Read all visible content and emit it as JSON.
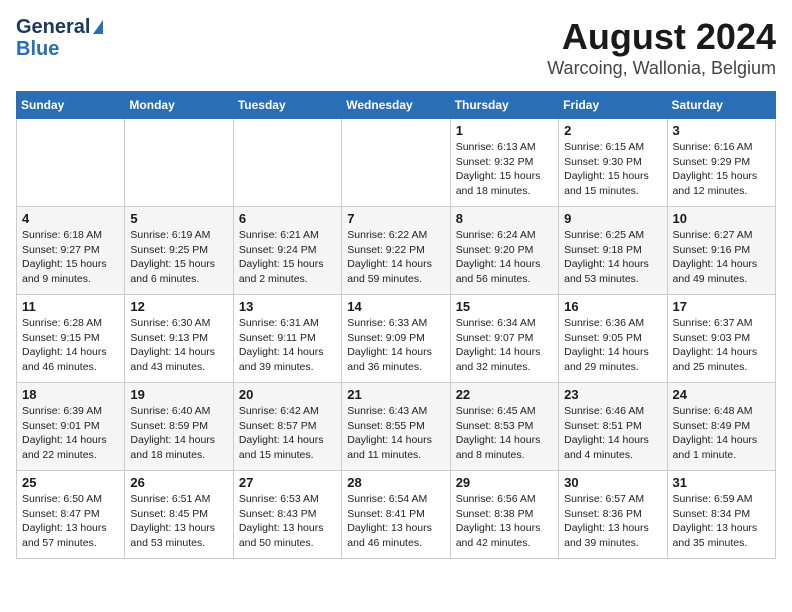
{
  "logo": {
    "line1": "General",
    "line2": "Blue"
  },
  "title": "August 2024",
  "subtitle": "Warcoing, Wallonia, Belgium",
  "days_of_week": [
    "Sunday",
    "Monday",
    "Tuesday",
    "Wednesday",
    "Thursday",
    "Friday",
    "Saturday"
  ],
  "weeks": [
    [
      {
        "day": "",
        "info": ""
      },
      {
        "day": "",
        "info": ""
      },
      {
        "day": "",
        "info": ""
      },
      {
        "day": "",
        "info": ""
      },
      {
        "day": "1",
        "info": "Sunrise: 6:13 AM\nSunset: 9:32 PM\nDaylight: 15 hours\nand 18 minutes."
      },
      {
        "day": "2",
        "info": "Sunrise: 6:15 AM\nSunset: 9:30 PM\nDaylight: 15 hours\nand 15 minutes."
      },
      {
        "day": "3",
        "info": "Sunrise: 6:16 AM\nSunset: 9:29 PM\nDaylight: 15 hours\nand 12 minutes."
      }
    ],
    [
      {
        "day": "4",
        "info": "Sunrise: 6:18 AM\nSunset: 9:27 PM\nDaylight: 15 hours\nand 9 minutes."
      },
      {
        "day": "5",
        "info": "Sunrise: 6:19 AM\nSunset: 9:25 PM\nDaylight: 15 hours\nand 6 minutes."
      },
      {
        "day": "6",
        "info": "Sunrise: 6:21 AM\nSunset: 9:24 PM\nDaylight: 15 hours\nand 2 minutes."
      },
      {
        "day": "7",
        "info": "Sunrise: 6:22 AM\nSunset: 9:22 PM\nDaylight: 14 hours\nand 59 minutes."
      },
      {
        "day": "8",
        "info": "Sunrise: 6:24 AM\nSunset: 9:20 PM\nDaylight: 14 hours\nand 56 minutes."
      },
      {
        "day": "9",
        "info": "Sunrise: 6:25 AM\nSunset: 9:18 PM\nDaylight: 14 hours\nand 53 minutes."
      },
      {
        "day": "10",
        "info": "Sunrise: 6:27 AM\nSunset: 9:16 PM\nDaylight: 14 hours\nand 49 minutes."
      }
    ],
    [
      {
        "day": "11",
        "info": "Sunrise: 6:28 AM\nSunset: 9:15 PM\nDaylight: 14 hours\nand 46 minutes."
      },
      {
        "day": "12",
        "info": "Sunrise: 6:30 AM\nSunset: 9:13 PM\nDaylight: 14 hours\nand 43 minutes."
      },
      {
        "day": "13",
        "info": "Sunrise: 6:31 AM\nSunset: 9:11 PM\nDaylight: 14 hours\nand 39 minutes."
      },
      {
        "day": "14",
        "info": "Sunrise: 6:33 AM\nSunset: 9:09 PM\nDaylight: 14 hours\nand 36 minutes."
      },
      {
        "day": "15",
        "info": "Sunrise: 6:34 AM\nSunset: 9:07 PM\nDaylight: 14 hours\nand 32 minutes."
      },
      {
        "day": "16",
        "info": "Sunrise: 6:36 AM\nSunset: 9:05 PM\nDaylight: 14 hours\nand 29 minutes."
      },
      {
        "day": "17",
        "info": "Sunrise: 6:37 AM\nSunset: 9:03 PM\nDaylight: 14 hours\nand 25 minutes."
      }
    ],
    [
      {
        "day": "18",
        "info": "Sunrise: 6:39 AM\nSunset: 9:01 PM\nDaylight: 14 hours\nand 22 minutes."
      },
      {
        "day": "19",
        "info": "Sunrise: 6:40 AM\nSunset: 8:59 PM\nDaylight: 14 hours\nand 18 minutes."
      },
      {
        "day": "20",
        "info": "Sunrise: 6:42 AM\nSunset: 8:57 PM\nDaylight: 14 hours\nand 15 minutes."
      },
      {
        "day": "21",
        "info": "Sunrise: 6:43 AM\nSunset: 8:55 PM\nDaylight: 14 hours\nand 11 minutes."
      },
      {
        "day": "22",
        "info": "Sunrise: 6:45 AM\nSunset: 8:53 PM\nDaylight: 14 hours\nand 8 minutes."
      },
      {
        "day": "23",
        "info": "Sunrise: 6:46 AM\nSunset: 8:51 PM\nDaylight: 14 hours\nand 4 minutes."
      },
      {
        "day": "24",
        "info": "Sunrise: 6:48 AM\nSunset: 8:49 PM\nDaylight: 14 hours\nand 1 minute."
      }
    ],
    [
      {
        "day": "25",
        "info": "Sunrise: 6:50 AM\nSunset: 8:47 PM\nDaylight: 13 hours\nand 57 minutes."
      },
      {
        "day": "26",
        "info": "Sunrise: 6:51 AM\nSunset: 8:45 PM\nDaylight: 13 hours\nand 53 minutes."
      },
      {
        "day": "27",
        "info": "Sunrise: 6:53 AM\nSunset: 8:43 PM\nDaylight: 13 hours\nand 50 minutes."
      },
      {
        "day": "28",
        "info": "Sunrise: 6:54 AM\nSunset: 8:41 PM\nDaylight: 13 hours\nand 46 minutes."
      },
      {
        "day": "29",
        "info": "Sunrise: 6:56 AM\nSunset: 8:38 PM\nDaylight: 13 hours\nand 42 minutes."
      },
      {
        "day": "30",
        "info": "Sunrise: 6:57 AM\nSunset: 8:36 PM\nDaylight: 13 hours\nand 39 minutes."
      },
      {
        "day": "31",
        "info": "Sunrise: 6:59 AM\nSunset: 8:34 PM\nDaylight: 13 hours\nand 35 minutes."
      }
    ]
  ]
}
